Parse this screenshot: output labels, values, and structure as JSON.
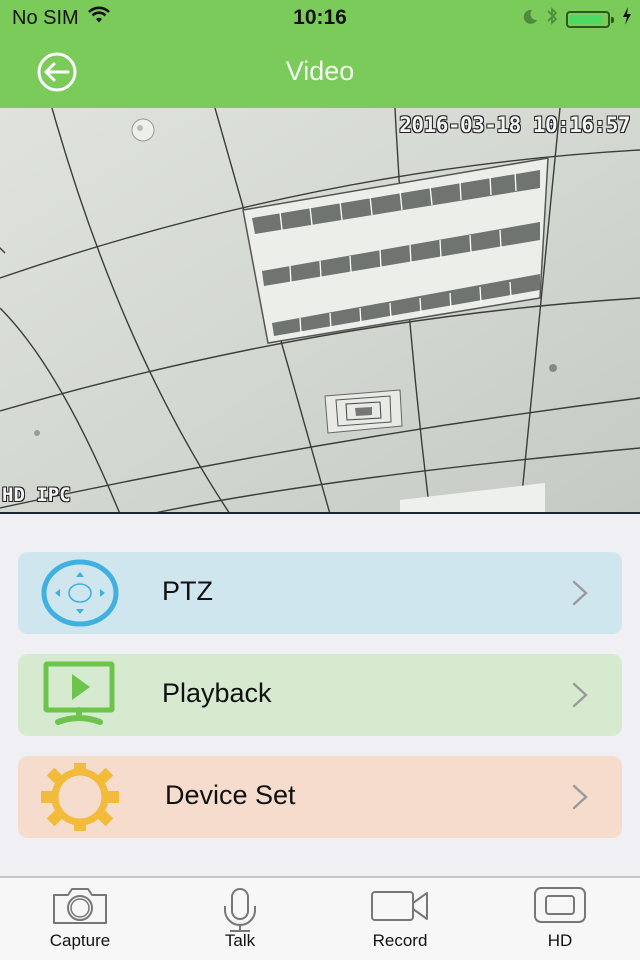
{
  "status_bar": {
    "carrier": "No SIM",
    "time": "10:16",
    "battery_level": 0.9,
    "icons": [
      "wifi-icon",
      "moon-icon",
      "bluetooth-icon",
      "battery-icon",
      "charging-bolt-icon"
    ]
  },
  "nav": {
    "title": "Video",
    "back_icon": "back-arrow-circle-icon"
  },
  "video": {
    "timestamp": "2016-03-18 10:16:57",
    "camera_name": "HD IPC"
  },
  "menu": {
    "items": [
      {
        "label": "PTZ",
        "icon": "ptz-joystick-icon",
        "bg_color": "#cfe6ef",
        "icon_color": "#3fb0e0"
      },
      {
        "label": "Playback",
        "icon": "monitor-play-icon",
        "bg_color": "#d6ead0",
        "icon_color": "#6cc44a"
      },
      {
        "label": "Device Set",
        "icon": "gear-icon",
        "bg_color": "#f5dccd",
        "icon_color": "#f2bb3a"
      }
    ]
  },
  "tabbar": {
    "tabs": [
      {
        "label": "Capture",
        "icon": "camera-icon"
      },
      {
        "label": "Talk",
        "icon": "microphone-icon"
      },
      {
        "label": "Record",
        "icon": "video-camera-icon"
      },
      {
        "label": "HD",
        "icon": "hd-screen-icon"
      }
    ]
  },
  "colors": {
    "nav_green": "#7bcb5a",
    "background": "#efeff4",
    "chevron": "#9a9a9a"
  }
}
